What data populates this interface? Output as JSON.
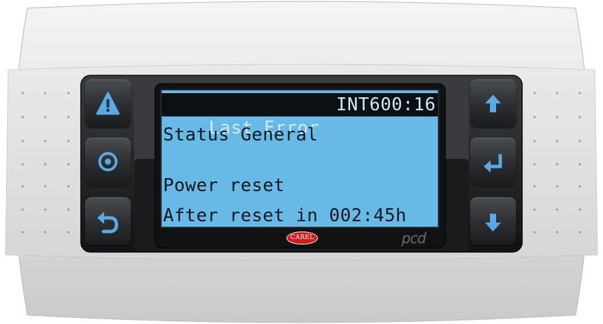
{
  "screen": {
    "header_left": "Last Error",
    "header_right": "INT600:16",
    "line2": "Status General",
    "line3": "",
    "line4": "Power reset",
    "line5": "After reset in 002:45h"
  },
  "brand": {
    "logo": "CAREL",
    "model": "pcd"
  },
  "buttons": {
    "alarm": "alarm-icon",
    "program": "program-icon",
    "escape": "escape-icon",
    "up": "arrow-up-icon",
    "enter": "enter-icon",
    "down": "arrow-down-icon"
  },
  "colors": {
    "lcd_background": "#68b9e6",
    "icon_blue": "#5aa9e6",
    "logo_red": "#d31a1a"
  }
}
